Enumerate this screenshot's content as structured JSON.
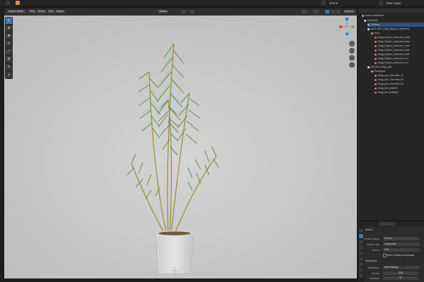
{
  "topbar": {
    "scene_label": "Scene",
    "view_layer_label": "View Layer"
  },
  "viewport_header": {
    "mode": "Object Mode",
    "view": "View",
    "select": "Select",
    "add": "Add",
    "object": "Object",
    "orientation": "Global",
    "options": "Options"
  },
  "outliner": {
    "scene_collection": "Scene Collection",
    "rows": [
      {
        "label": "Collection",
        "depth": 0,
        "kind": "collection"
      },
      {
        "label": "Camera",
        "depth": 1,
        "kind": "camera",
        "selected": true
      },
      {
        "label": "plant_002_Zagg_Dypsis_lutescens",
        "depth": 1,
        "kind": "collection"
      },
      {
        "label": "Plant",
        "depth": 2,
        "kind": "object"
      },
      {
        "label": "Zagg_Dypsis_lutescens_leav",
        "depth": 3,
        "kind": "mesh"
      },
      {
        "label": "Zagg_Dypsis_lutescens_leav",
        "depth": 3,
        "kind": "mesh"
      },
      {
        "label": "Zagg_Dypsis_lutescens_leaf",
        "depth": 3,
        "kind": "mesh"
      },
      {
        "label": "Zagg_Dypsis_lutescens_leaf",
        "depth": 3,
        "kind": "mesh"
      },
      {
        "label": "Zagg_Dypsis_lutescens_leaf",
        "depth": 3,
        "kind": "mesh"
      },
      {
        "label": "Zagg_Dypsis_lutescens_tru",
        "depth": 3,
        "kind": "mesh"
      },
      {
        "label": "Zagg_Dypsis_lutescens_tru",
        "depth": 3,
        "kind": "mesh"
      },
      {
        "label": "pot_000_Zagg_pot",
        "depth": 1,
        "kind": "collection"
      },
      {
        "label": "Flowerpot",
        "depth": 2,
        "kind": "object"
      },
      {
        "label": "Zagg_pot_Concrete_01",
        "depth": 3,
        "kind": "mesh"
      },
      {
        "label": "Zagg_pot_Concrete_02",
        "depth": 3,
        "kind": "mesh"
      },
      {
        "label": "Zagg_pot_Concrete_03",
        "depth": 3,
        "kind": "mesh"
      },
      {
        "label": "Zagg_pot_ground",
        "depth": 3,
        "kind": "mesh"
      },
      {
        "label": "Zagg_pot_pebbles",
        "depth": 3,
        "kind": "mesh"
      }
    ]
  },
  "properties": {
    "header": "Scene",
    "render_engine_label": "Render Engine",
    "render_engine": "Cycles",
    "feature_set_label": "Feature Set",
    "feature_set": "Supported",
    "device_label": "Device",
    "device": "CPU",
    "osl_label": "Open Shading Language",
    "sampling_label": "Sampling",
    "integrator_label": "Integrator",
    "integrator": "Path Tracing",
    "render_label": "Render",
    "render_value": "128",
    "viewport_label": "Viewport",
    "viewport_value": "32"
  },
  "colors": {
    "viewport_bg": "#c9c9c9",
    "leaf": "#6f9a4e",
    "leaf_dark": "#3f6a2a",
    "pot": "#dcdcdc",
    "accent_blue": "#4772b3"
  }
}
